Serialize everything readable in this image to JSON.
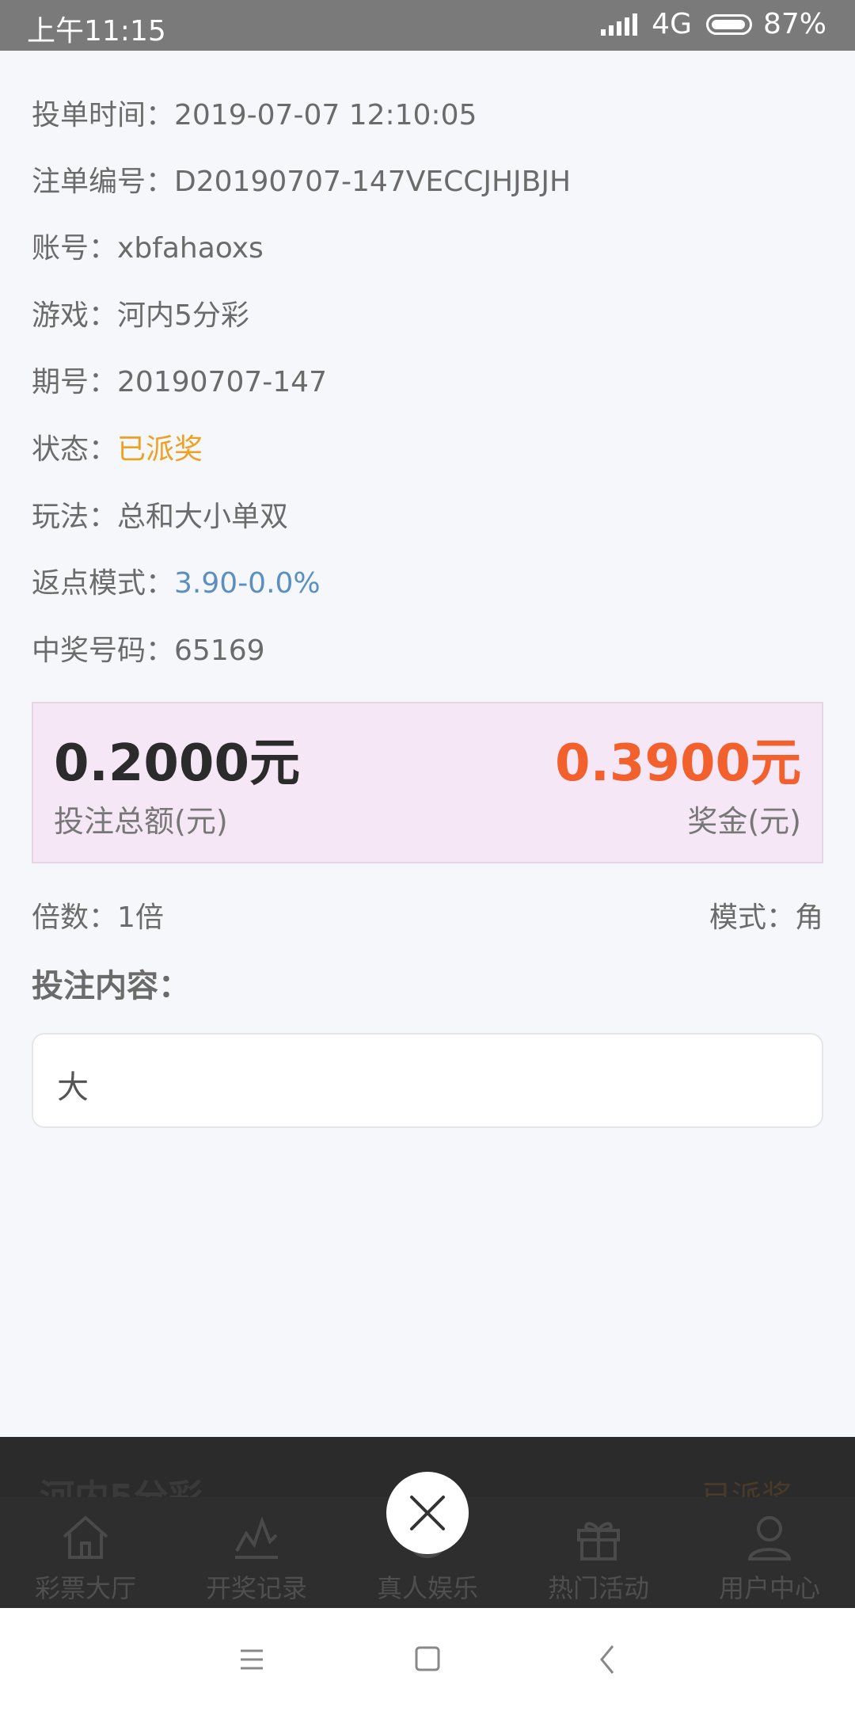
{
  "status_bar": {
    "time": "上午11:15",
    "network": "4G",
    "battery": "87%"
  },
  "details": [
    {
      "label": "投单时间",
      "value": "2019-07-07 12:10:05",
      "style": "normal"
    },
    {
      "label": "注单编号",
      "value": "D20190707-147VECCJHJBJH",
      "style": "normal"
    },
    {
      "label": "账号",
      "value": "xbfahaoxs",
      "style": "normal"
    },
    {
      "label": "游戏",
      "value": "河内5分彩",
      "style": "normal"
    },
    {
      "label": "期号",
      "value": "20190707-147",
      "style": "normal"
    },
    {
      "label": "状态",
      "value": "已派奖",
      "style": "orange"
    },
    {
      "label": "玩法",
      "value": "总和大小单双",
      "style": "normal"
    },
    {
      "label": "返点模式",
      "value": "3.90-0.0%",
      "style": "blue"
    },
    {
      "label": "中奖号码",
      "value": "65169",
      "style": "normal"
    }
  ],
  "summary": {
    "bet_amount": "0.2000元",
    "bet_amount_label": "投注总额(元)",
    "prize": "0.3900元",
    "prize_label": "奖金(元)"
  },
  "multiplier": "倍数：1倍",
  "mode": "模式：角",
  "bet_content_title": "投注内容：",
  "bet_content": "大",
  "background_row": {
    "game": "河内5分彩",
    "status": "已派奖"
  },
  "tabs": [
    {
      "label": "彩票大厅",
      "icon": "home-icon"
    },
    {
      "label": "开奖记录",
      "icon": "chart-icon"
    },
    {
      "label": "真人娱乐",
      "icon": "live-icon"
    },
    {
      "label": "热门活动",
      "icon": "gift-icon"
    },
    {
      "label": "用户中心",
      "icon": "user-icon"
    }
  ],
  "colors": {
    "orange": "#f0a020",
    "blue": "#5a8fc0",
    "prize": "#f2602e",
    "summary_bg": "#f6e7f6"
  }
}
